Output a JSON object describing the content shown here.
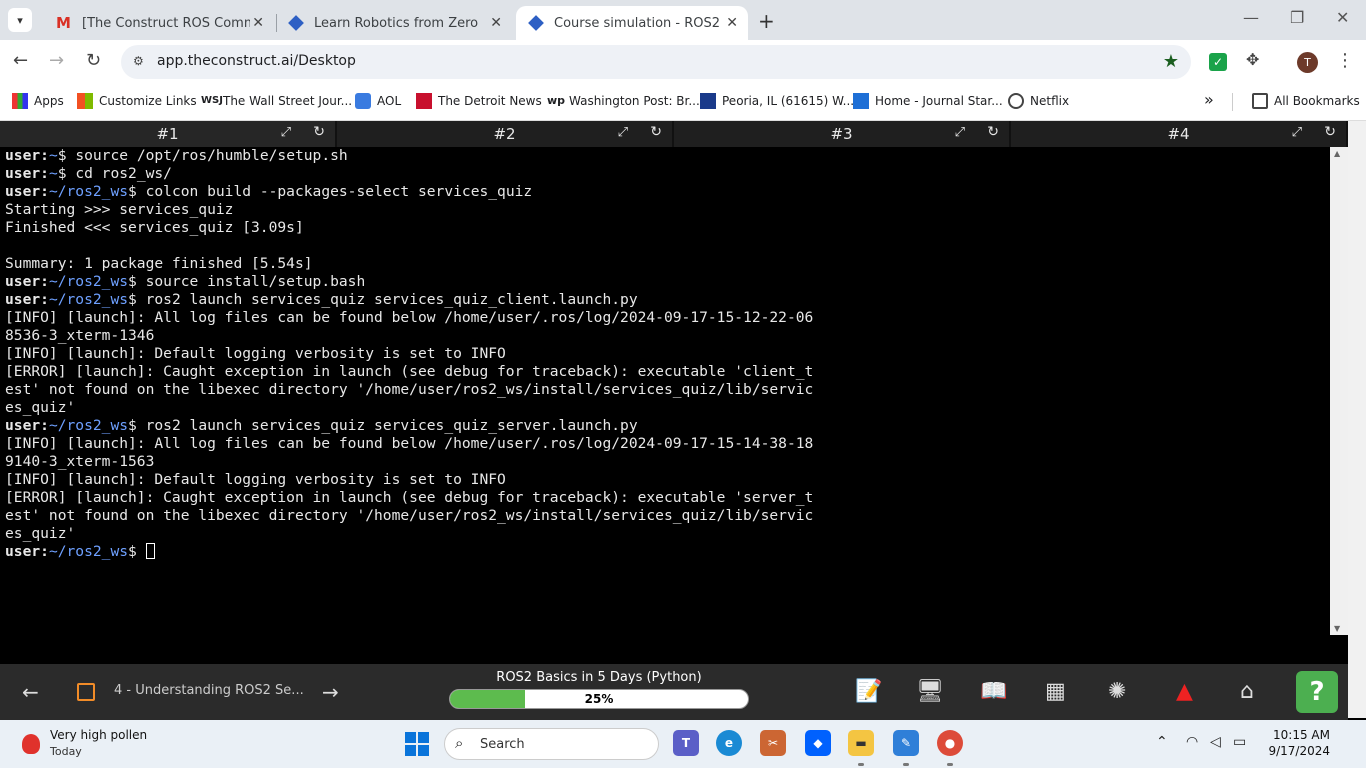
{
  "browser": {
    "tabs": [
      {
        "title": "[The Construct ROS Community]"
      },
      {
        "title": "Learn Robotics from Zero | Robotics"
      },
      {
        "title": "Course simulation - ROS2 Basics"
      }
    ],
    "url": "app.theconstruct.ai/Desktop",
    "avatar_letter": "T",
    "bookmarks": [
      "Apps",
      "Customize Links",
      "The Wall Street Jour...",
      "AOL",
      "The Detroit News",
      "Washington Post: Br...",
      "Peoria, IL (61615) W...",
      "Home - Journal Star...",
      "Netflix"
    ],
    "all_bookmarks": "All Bookmarks"
  },
  "terminal": {
    "tabs": [
      "#1",
      "#2",
      "#3",
      "#4"
    ],
    "lines": [
      {
        "user": "user",
        "path": "~",
        "cmd": "source /opt/ros/humble/setup.sh"
      },
      {
        "user": "user",
        "path": "~",
        "cmd": "cd ros2_ws/"
      },
      {
        "user": "user",
        "path": "~/ros2_ws",
        "cmd": "colcon build --packages-select services_quiz"
      },
      {
        "text": "Starting >>> services_quiz"
      },
      {
        "text": "Finished <<< services_quiz [3.09s]"
      },
      {
        "text": ""
      },
      {
        "text": "Summary: 1 package finished [5.54s]"
      },
      {
        "user": "user",
        "path": "~/ros2_ws",
        "cmd": "source install/setup.bash"
      },
      {
        "user": "user",
        "path": "~/ros2_ws",
        "cmd": "ros2 launch services_quiz services_quiz_client.launch.py"
      },
      {
        "text": "[INFO] [launch]: All log files can be found below /home/user/.ros/log/2024-09-17-15-12-22-06"
      },
      {
        "text": "8536-3_xterm-1346"
      },
      {
        "text": "[INFO] [launch]: Default logging verbosity is set to INFO"
      },
      {
        "text": "[ERROR] [launch]: Caught exception in launch (see debug for traceback): executable 'client_t"
      },
      {
        "text": "est' not found on the libexec directory '/home/user/ros2_ws/install/services_quiz/lib/servic"
      },
      {
        "text": "es_quiz'"
      },
      {
        "user": "user",
        "path": "~/ros2_ws",
        "cmd": "ros2 launch services_quiz services_quiz_server.launch.py"
      },
      {
        "text": "[INFO] [launch]: All log files can be found below /home/user/.ros/log/2024-09-17-15-14-38-18"
      },
      {
        "text": "9140-3_xterm-1563"
      },
      {
        "text": "[INFO] [launch]: Default logging verbosity is set to INFO"
      },
      {
        "text": "[ERROR] [launch]: Caught exception in launch (see debug for traceback): executable 'server_t"
      },
      {
        "text": "est' not found on the libexec directory '/home/user/ros2_ws/install/services_quiz/lib/servic"
      },
      {
        "text": "es_quiz'"
      },
      {
        "user": "user",
        "path": "~/ros2_ws",
        "cmd": "",
        "cursor": true
      }
    ]
  },
  "course": {
    "unit": "4 - Understanding ROS2 Se...",
    "title": "ROS2 Basics in 5 Days (Python)",
    "progress_percent": 25,
    "progress_label": "25%"
  },
  "taskbar": {
    "weather_title": "Very high pollen",
    "weather_sub": "Today",
    "search_placeholder": "Search",
    "time": "10:15 AM",
    "date": "9/17/2024"
  },
  "colors": {
    "progress_fill": "#5dbb4e",
    "prompt_path": "#6ea0ff",
    "help_button": "#4caf50"
  }
}
